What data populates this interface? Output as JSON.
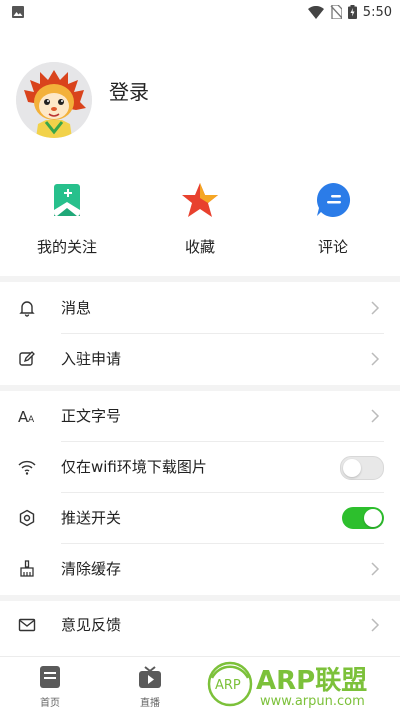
{
  "status_bar": {
    "time": "5:50"
  },
  "profile": {
    "login_label": "登录"
  },
  "quick_actions": [
    {
      "label": "我的关注",
      "icon": "bookmark-icon",
      "color": "#27c08c"
    },
    {
      "label": "收藏",
      "icon": "star-icon",
      "color": "#e8412e"
    },
    {
      "label": "评论",
      "icon": "comment-icon",
      "color": "#2b7ce8"
    }
  ],
  "menu": {
    "messages": "消息",
    "settle_apply": "入驻申请",
    "font_size": "正文字号",
    "wifi_images": "仅在wifi环境下载图片",
    "push_switch": "推送开关",
    "clear_cache": "清除缓存",
    "feedback": "意见反馈"
  },
  "toggles": {
    "wifi_images_on": false,
    "push_on": true,
    "on_color": "#2dbf2d"
  },
  "tabbar": {
    "home": "首页",
    "live": "直播"
  },
  "watermark": {
    "brand": "ARP联盟",
    "url": "www.arpun.com",
    "badge": "ARP",
    "color": "#7cc13a"
  }
}
